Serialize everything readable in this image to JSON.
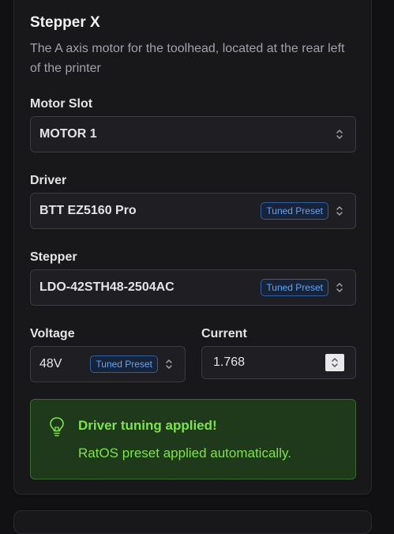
{
  "section": {
    "title": "Stepper X",
    "description": "The A axis motor for the toolhead, located at the rear left of the printer"
  },
  "motor_slot": {
    "label": "Motor Slot",
    "value": "MOTOR 1"
  },
  "driver": {
    "label": "Driver",
    "value": "BTT EZ5160 Pro",
    "badge": "Tuned Preset"
  },
  "stepper": {
    "label": "Stepper",
    "value": "LDO-42STH48-2504AC",
    "badge": "Tuned Preset"
  },
  "voltage": {
    "label": "Voltage",
    "value": "48V",
    "badge": "Tuned Preset"
  },
  "current": {
    "label": "Current",
    "value": "1.768"
  },
  "alert": {
    "title": "Driver tuning applied!",
    "message": "RatOS preset applied automatically."
  },
  "colors": {
    "accent_blue": "#60a5fa",
    "success_green": "#7ee24a",
    "background": "#111114"
  }
}
